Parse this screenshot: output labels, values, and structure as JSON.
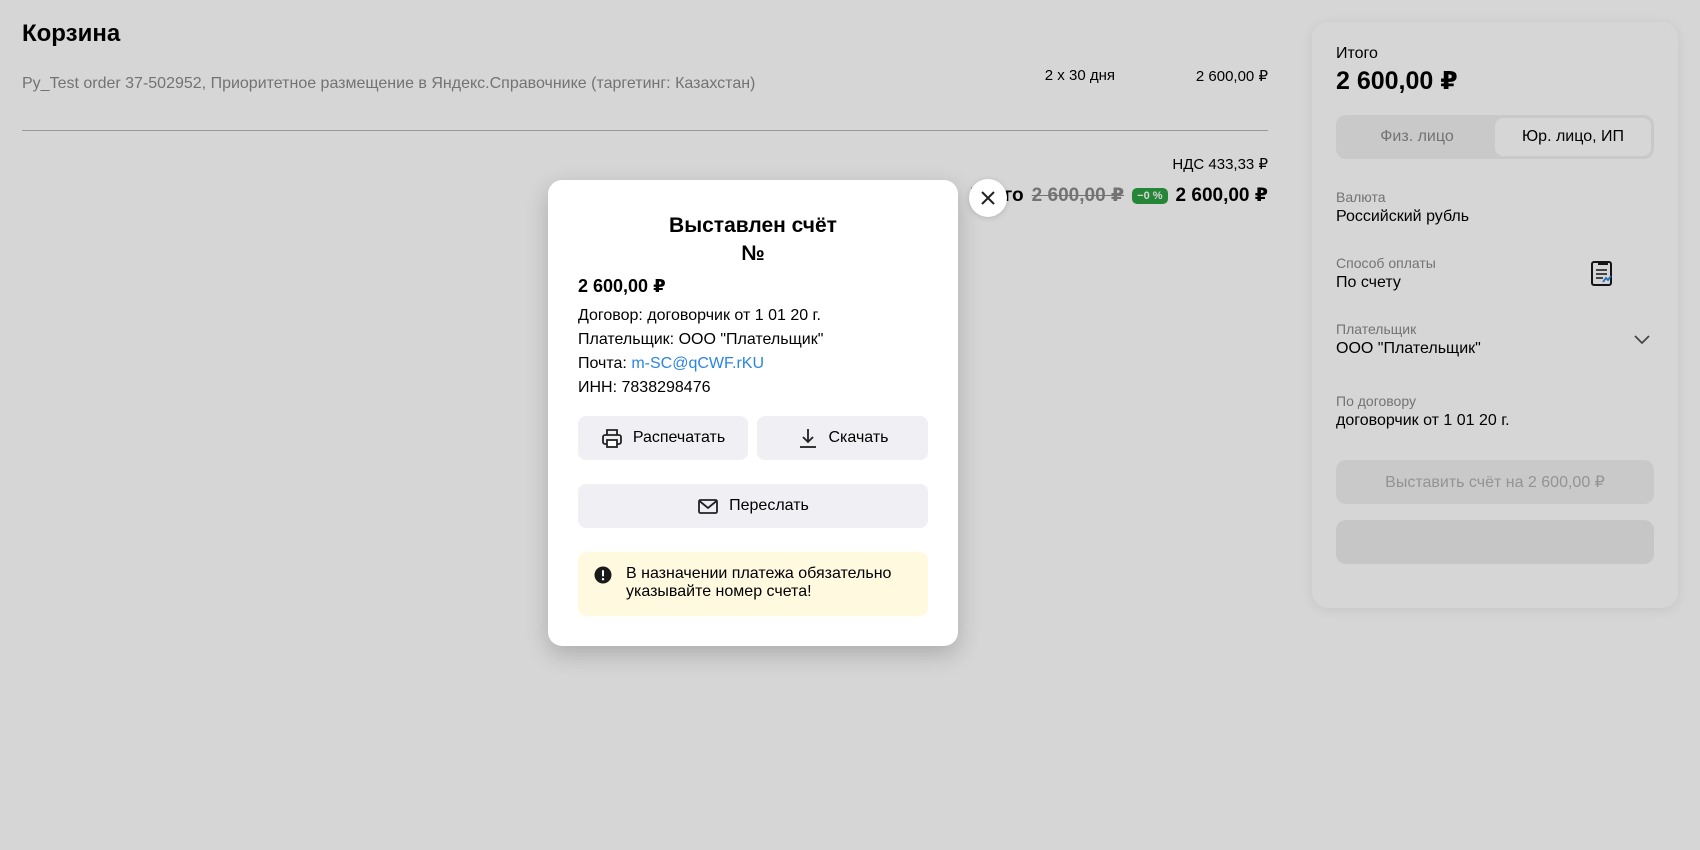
{
  "page": {
    "title": "Корзина",
    "order": {
      "name": "Py_Test order 37-502952, Приоритетное размещение в Яндекс.Справочнике (таргетинг: Казахстан)",
      "period": "2 x 30 дня",
      "price": "2 600,00 ₽"
    },
    "vat": "НДС 433,33 ₽",
    "total": {
      "label": "Итого",
      "old": "2 600,00 ₽",
      "discount": "−0 %",
      "value": "2 600,00 ₽"
    }
  },
  "sidebar": {
    "total_label": "Итого",
    "total_value": "2 600,00 ₽",
    "payer_types": [
      "Физ. лицо",
      "Юр. лицо, ИП"
    ],
    "currency_label": "Валюта",
    "currency_value": "Российский рубль",
    "payment_label": "Способ оплаты",
    "payment_value": "По счету",
    "payer_label": "Плательщик",
    "payer_value": "ООО \"Плательщик\"",
    "contract_label": "По договору",
    "contract_value": "договорчик от 1 01 20 г.",
    "submit_label": "Выставить счёт на 2 600,00 ₽"
  },
  "modal": {
    "title_line1": "Выставлен счёт",
    "title_line2": "№",
    "amount": "2 600,00 ₽",
    "contract": "Договор: договорчик от 1 01 20 г.",
    "payer": "Плательщик: ООО \"Плательщик\"",
    "email_label": "Почта: ",
    "email": "m-SC@qCWF.rKU",
    "inn": "ИНН: 7838298476",
    "print_label": "Распечатать",
    "download_label": "Скачать",
    "forward_label": "Переслать",
    "notice": "В назначении платежа обязательно указывайте номер счета!"
  },
  "colors": {
    "link": "#2b85e4",
    "discount": "#2ea043",
    "notice_bg": "#fff9e0"
  }
}
